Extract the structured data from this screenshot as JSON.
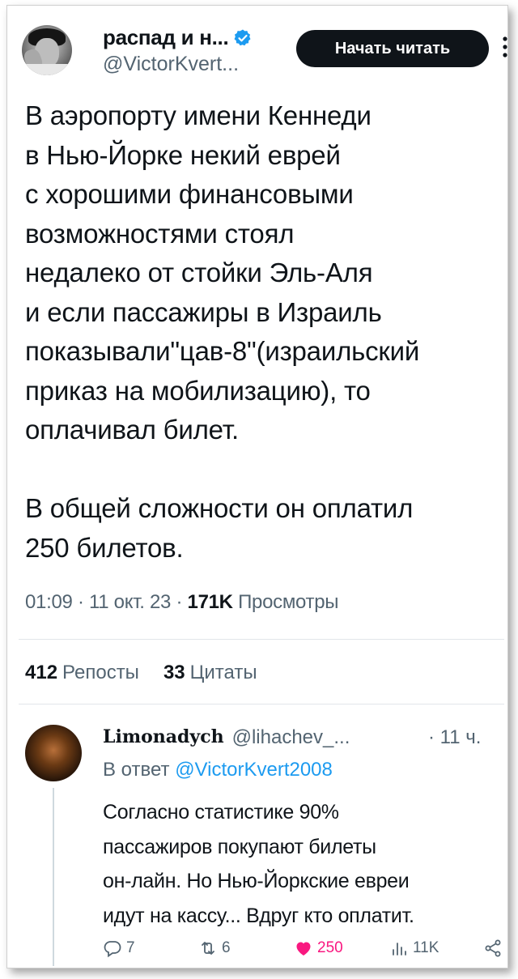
{
  "header": {
    "display_name": "распад и н...",
    "handle": "@VictorKvert...",
    "follow_label": "Начать читать"
  },
  "tweet": {
    "text": "В аэропорту имени Кеннеди\nв Нью-Йорке некий еврей\nс хорошими финансовыми\nвозможностями стоял\nнедалеко от стойки Эль-Аля\nи если пассажиры в Израиль\nпоказывали\"цав-8\"(израильский\nприказ на мобилизацию), то\nоплачивал билет.\n\nВ общей сложности он оплатил\n250 билетов.",
    "time": "01:09",
    "date": "11 окт. 23",
    "views_count": "171K",
    "views_label": "Просмотры"
  },
  "stats": {
    "reposts_count": "412",
    "reposts_label": "Репосты",
    "quotes_count": "33",
    "quotes_label": "Цитаты"
  },
  "reply": {
    "name": "Limonadych",
    "handle": "@lihachev_...",
    "time": "· 11 ч.",
    "in_reply_prefix": "В ответ",
    "in_reply_mention": "@VictorKvert2008",
    "text": "Согласно статистике 90%\nпассажиров покупают билеты\nон-лайн. Но Нью-Йоркские евреи\nидут на кассу... Вдруг кто оплатит.",
    "replies": "7",
    "retweets": "6",
    "likes": "250",
    "views": "11K"
  },
  "colors": {
    "accent": "#1d9bf0",
    "like": "#f91880",
    "secondary_text": "#536471",
    "primary_text": "#0f1419"
  },
  "icons": [
    "verified-badge-icon",
    "more-dots-icon",
    "reply-icon",
    "retweet-icon",
    "heart-icon",
    "views-icon",
    "share-icon"
  ]
}
